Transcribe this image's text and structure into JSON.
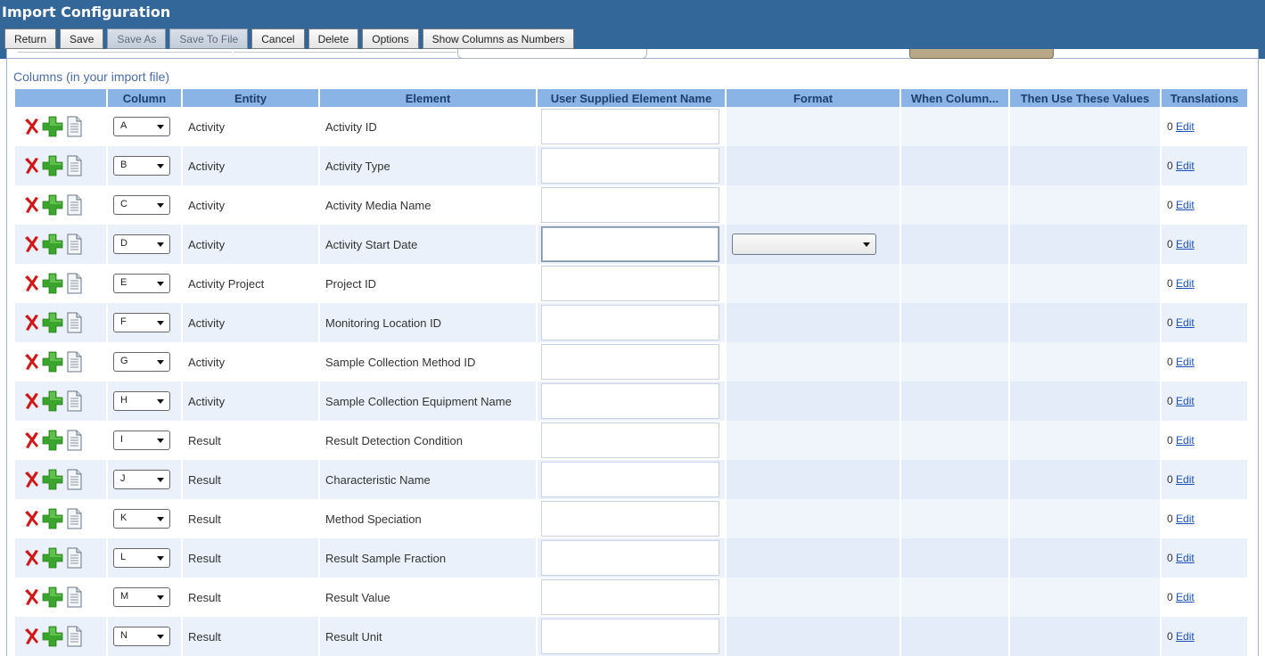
{
  "header": {
    "title": "Import Configuration",
    "buttons": [
      {
        "label": "Return",
        "enabled": true
      },
      {
        "label": "Save",
        "enabled": true
      },
      {
        "label": "Save As",
        "enabled": false
      },
      {
        "label": "Save To File",
        "enabled": false
      },
      {
        "label": "Cancel",
        "enabled": true
      },
      {
        "label": "Delete",
        "enabled": true
      },
      {
        "label": "Options",
        "enabled": true
      },
      {
        "label": "Show Columns as Numbers",
        "enabled": true
      }
    ]
  },
  "section": {
    "title": "Columns (in your import file)"
  },
  "table": {
    "headers": [
      "",
      "Column",
      "Entity",
      "Element",
      "User Supplied Element Name",
      "Format",
      "When Column...",
      "Then Use These Values",
      "Translations"
    ],
    "rows": [
      {
        "column": "A",
        "entity": "Activity",
        "element": "Activity ID",
        "translations_count": "0",
        "translations_link": "Edit",
        "format_select": false
      },
      {
        "column": "B",
        "entity": "Activity",
        "element": "Activity Type",
        "translations_count": "0",
        "translations_link": "Edit",
        "format_select": false
      },
      {
        "column": "C",
        "entity": "Activity",
        "element": "Activity Media Name",
        "translations_count": "0",
        "translations_link": "Edit",
        "format_select": false
      },
      {
        "column": "D",
        "entity": "Activity",
        "element": "Activity Start Date",
        "translations_count": "0",
        "translations_link": "Edit",
        "format_select": true
      },
      {
        "column": "E",
        "entity": "Activity Project",
        "element": "Project ID",
        "translations_count": "0",
        "translations_link": "Edit",
        "format_select": false
      },
      {
        "column": "F",
        "entity": "Activity",
        "element": "Monitoring Location ID",
        "translations_count": "0",
        "translations_link": "Edit",
        "format_select": false
      },
      {
        "column": "G",
        "entity": "Activity",
        "element": "Sample Collection Method ID",
        "translations_count": "0",
        "translations_link": "Edit",
        "format_select": false
      },
      {
        "column": "H",
        "entity": "Activity",
        "element": "Sample Collection Equipment Name",
        "translations_count": "0",
        "translations_link": "Edit",
        "format_select": false
      },
      {
        "column": "I",
        "entity": "Result",
        "element": "Result Detection Condition",
        "translations_count": "0",
        "translations_link": "Edit",
        "format_select": false
      },
      {
        "column": "J",
        "entity": "Result",
        "element": "Characteristic Name",
        "translations_count": "0",
        "translations_link": "Edit",
        "format_select": false
      },
      {
        "column": "K",
        "entity": "Result",
        "element": "Method Speciation",
        "translations_count": "0",
        "translations_link": "Edit",
        "format_select": false
      },
      {
        "column": "L",
        "entity": "Result",
        "element": "Result Sample Fraction",
        "translations_count": "0",
        "translations_link": "Edit",
        "format_select": false
      },
      {
        "column": "M",
        "entity": "Result",
        "element": "Result Value",
        "translations_count": "0",
        "translations_link": "Edit",
        "format_select": false
      },
      {
        "column": "N",
        "entity": "Result",
        "element": "Result Unit",
        "translations_count": "0",
        "translations_link": "Edit",
        "format_select": false
      }
    ],
    "row_icons": [
      "delete-icon",
      "add-icon",
      "document-icon"
    ]
  },
  "colors": {
    "header_bg": "#336699",
    "column_header_bg": "#8ab3e6",
    "alt_row_bg": "#eaf1fb",
    "link": "#1a4fb8",
    "delete_icon": "#d01818",
    "add_icon": "#3aa52c"
  }
}
